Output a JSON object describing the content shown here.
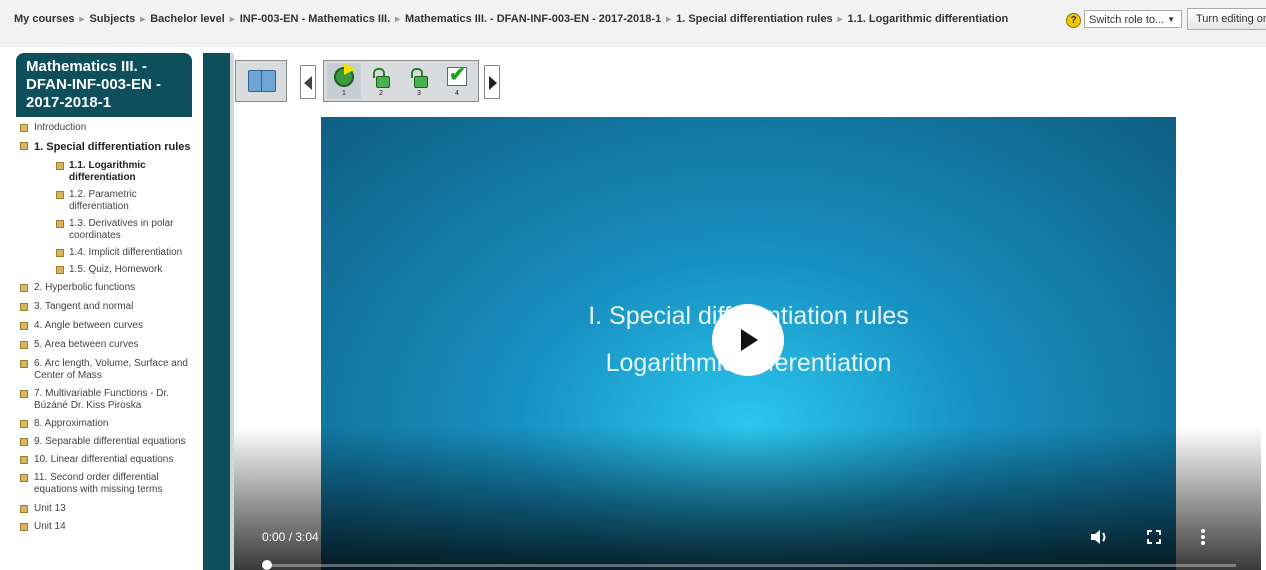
{
  "breadcrumb": {
    "items": [
      "My courses",
      "Subjects",
      "Bachelor level",
      "INF-003-EN - Mathematics III.",
      "Mathematics III. - DFAN-INF-003-EN - 2017-2018-1",
      "1. Special differentiation rules",
      "1.1. Logarithmic differentiation"
    ]
  },
  "header": {
    "help_glyph": "?",
    "switch_role": "Switch role to...",
    "edit_button": "Turn editing on"
  },
  "sidebar": {
    "course_title": "Mathematics III. - DFAN-INF-003-EN - 2017-2018-1",
    "items": [
      {
        "label": "Introduction"
      },
      {
        "label": "1. Special differentiation rules"
      },
      {
        "label": "1.1. Logarithmic differentiation"
      },
      {
        "label": "1.2. Parametric differentiation"
      },
      {
        "label": "1.3. Derivatives in polar coordinates"
      },
      {
        "label": "1.4. Implicit differentiation"
      },
      {
        "label": "1.5. Quiz, Homework"
      },
      {
        "label": "2. Hyperbolic functions"
      },
      {
        "label": "3. Tangent and normal"
      },
      {
        "label": "4. Angle between curves"
      },
      {
        "label": "5. Area between curves"
      },
      {
        "label": "6. Arc length, Volume, Surface and Center of Mass"
      },
      {
        "label": "7. Multivariable Functions - Dr. Búzáné Dr. Kiss Piroska"
      },
      {
        "label": "8. Approximation"
      },
      {
        "label": "9. Separable differential equations"
      },
      {
        "label": "10. Linear differential equations"
      },
      {
        "label": "11. Second order differential equations with missing terms"
      },
      {
        "label": "Unit 13"
      },
      {
        "label": "Unit 14"
      }
    ]
  },
  "pagenav": {
    "pages": [
      "1",
      "2",
      "3",
      "4"
    ]
  },
  "video": {
    "title_line1": "I. Special differentiation rules",
    "title_line2": "Logarithmic differentiation",
    "time": "0:00 / 3:04",
    "progress": 0
  },
  "colors": {
    "sidebar_accent": "#0d4f5a",
    "bullet": "#d8b563",
    "video_bg": "#1790c1"
  }
}
